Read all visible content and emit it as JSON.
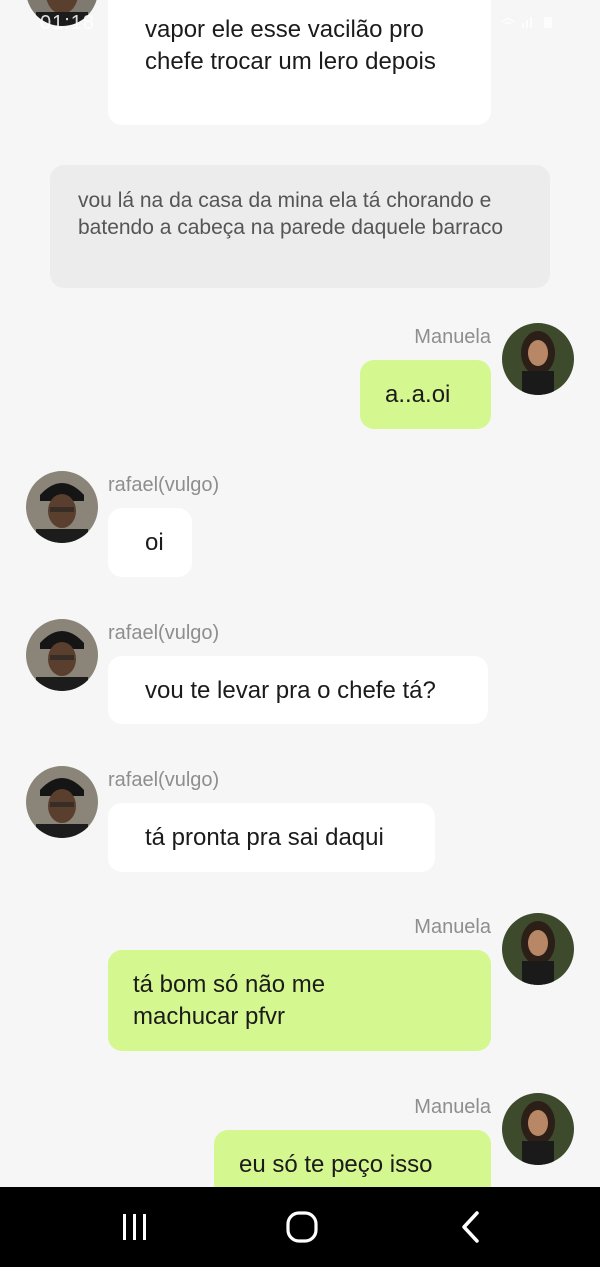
{
  "status_bar": {
    "time": "01:18",
    "indicators": "wifi-icon signal-icon battery-icon"
  },
  "messages": [
    {
      "sender": "rafael(vulgo)",
      "side": "left",
      "text": "vapor ele esse vacilão pro chefe trocar um lero depois"
    },
    {
      "type": "narration",
      "text": "vou lá na da casa da mina ela tá chorando e batendo a cabeça na parede daquele barraco"
    },
    {
      "sender": "Manuela",
      "side": "right",
      "text": "a..a.oi"
    },
    {
      "sender": "rafael(vulgo)",
      "side": "left",
      "text": "oi"
    },
    {
      "sender": "rafael(vulgo)",
      "side": "left",
      "text": "vou te levar pra o chefe tá?"
    },
    {
      "sender": "rafael(vulgo)",
      "side": "left",
      "text": "tá pronta pra sai daqui"
    },
    {
      "sender": "Manuela",
      "side": "right",
      "text": "tá bom só não me machucar pfvr"
    },
    {
      "sender": "Manuela",
      "side": "right",
      "text": "eu só te peço isso"
    }
  ],
  "colors": {
    "background": "#f6f6f6",
    "bubble_left": "#ffffff",
    "bubble_right": "#d5f78f",
    "narration_bubble": "#ececec",
    "name_text": "#8e8e8e",
    "nav_bar": "#000000"
  },
  "nav": {
    "recent_icon": "recent-apps-icon",
    "home_icon": "home-icon",
    "back_icon": "back-icon"
  }
}
